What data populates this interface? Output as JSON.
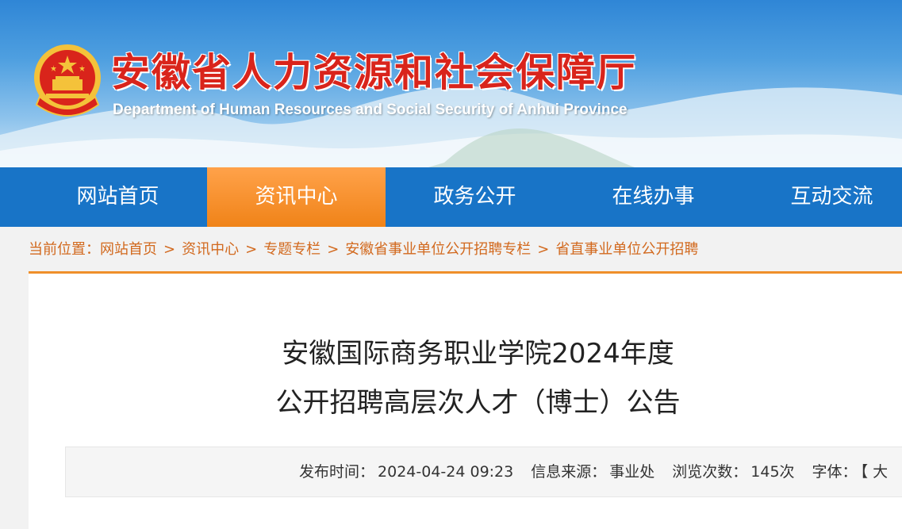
{
  "header": {
    "title": "安徽省人力资源和社会保障厅",
    "subtitle": "Department of Human Resources and Social Security of Anhui Province"
  },
  "nav": {
    "items": [
      {
        "label": "网站首页",
        "active": false
      },
      {
        "label": "资讯中心",
        "active": true
      },
      {
        "label": "政务公开",
        "active": false
      },
      {
        "label": "在线办事",
        "active": false
      },
      {
        "label": "互动交流",
        "active": false
      }
    ],
    "active_color": "#f08318",
    "bar_color": "#1874c7"
  },
  "breadcrumb": {
    "prefix": "当前位置：",
    "sep": ">",
    "items": [
      "网站首页",
      "资讯中心",
      "专题专栏",
      "安徽省事业单位公开招聘专栏",
      "省直事业单位公开招聘"
    ]
  },
  "article": {
    "title_line1": "安徽国际商务职业学院2024年度",
    "title_line2": "公开招聘高层次人才（博士）公告",
    "meta": {
      "publish_label": "发布时间：",
      "publish_time": "2024-04-24 09:23",
      "source_label": "信息来源：",
      "source": "事业处",
      "views_label": "浏览次数：",
      "views": "145次",
      "font_label": "字体：",
      "font_bracket": "【 大"
    }
  },
  "icons": {
    "emblem": "national-emblem-icon"
  }
}
